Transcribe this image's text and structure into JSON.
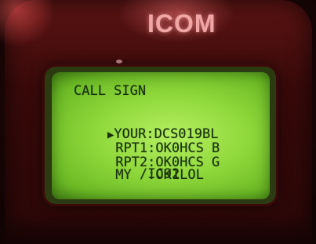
{
  "device": {
    "brand": "ICOM"
  },
  "screen": {
    "title": "CALL SIGN",
    "cursor_icon": "triangle-right",
    "rows": [
      {
        "label": "YOUR",
        "value": "DCS019BL"
      },
      {
        "label": "RPT1",
        "value": "OK0HCS B"
      },
      {
        "label": "RPT2",
        "value": "OK0HCS G"
      },
      {
        "label": "MY  ",
        "value": "OK1LOL"
      }
    ],
    "my_suffix": "/IC92"
  },
  "colors": {
    "lcd_backlight": "#9ee04a",
    "lcd_text": "#17320a",
    "body": "#3a0a0a",
    "logo": "#f1a6a6"
  }
}
